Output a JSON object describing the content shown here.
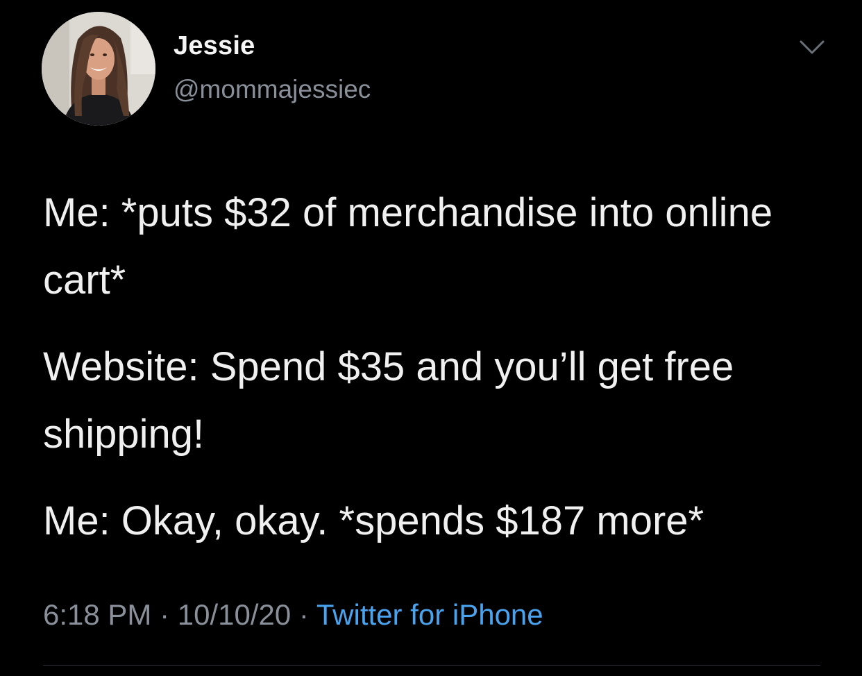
{
  "author": {
    "display_name": "Jessie",
    "handle": "@mommajessiec",
    "avatar_icon": "profile-photo"
  },
  "menu": {
    "icon": "chevron-down-icon"
  },
  "tweet": {
    "paragraphs": [
      "Me: *puts $32 of merchandise into online cart*",
      "Website: Spend $35 and you’ll get free shipping!",
      "Me: Okay, okay. *spends $187 more*"
    ]
  },
  "meta": {
    "time": "6:18 PM",
    "separator_1": " · ",
    "date": "10/10/20",
    "separator_2": " · ",
    "source": "Twitter for iPhone"
  },
  "colors": {
    "background": "#000000",
    "text": "#f0f0f0",
    "muted": "#8a9099",
    "link": "#4aa3ee"
  }
}
